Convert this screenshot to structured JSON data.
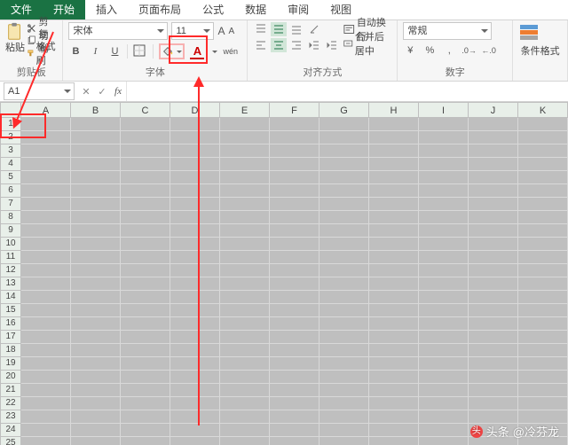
{
  "tabs": {
    "file": "文件",
    "home": "开始",
    "insert": "插入",
    "layout": "页面布局",
    "formulas": "公式",
    "data": "数据",
    "review": "审阅",
    "view": "视图"
  },
  "clipboard": {
    "cut": "剪切",
    "copy": "复制",
    "painter": "格式刷",
    "paste": "粘贴",
    "group": "剪贴板"
  },
  "font": {
    "name": "宋体",
    "size": "11",
    "group": "字体",
    "wen": "wén"
  },
  "align": {
    "wrap": "自动换行",
    "merge": "合并后居中",
    "group": "对齐方式"
  },
  "number": {
    "format": "常规",
    "group": "数字"
  },
  "style": {
    "cond": "条件格式",
    "group": ""
  },
  "namebox": "A1",
  "columns": [
    "A",
    "B",
    "C",
    "D",
    "E",
    "F",
    "G",
    "H",
    "I",
    "J",
    "K"
  ],
  "rows": [
    "1",
    "2",
    "3",
    "4",
    "5",
    "6",
    "7",
    "8",
    "9",
    "10",
    "11",
    "12",
    "13",
    "14",
    "15",
    "16",
    "17",
    "18",
    "19",
    "20",
    "21",
    "22",
    "23",
    "24",
    "25"
  ],
  "watermark": {
    "prefix": "头条",
    "author": "@冷芬龙"
  }
}
